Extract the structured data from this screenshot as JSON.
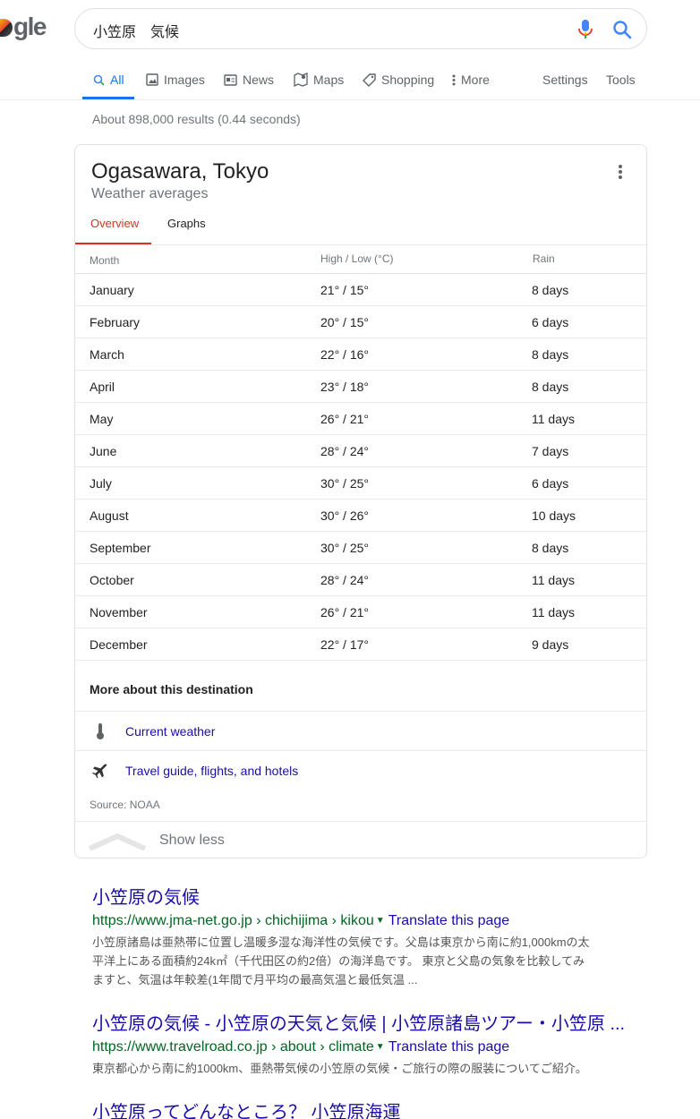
{
  "logo": {
    "text_o": "o",
    "text_gle": "gle"
  },
  "search": {
    "query": "小笠原　気候"
  },
  "tabs": [
    {
      "label": "All"
    },
    {
      "label": "Images"
    },
    {
      "label": "News"
    },
    {
      "label": "Maps"
    },
    {
      "label": "Shopping"
    },
    {
      "label": "More"
    }
  ],
  "tools": {
    "settings": "Settings",
    "tools": "Tools"
  },
  "stats": "About 898,000 results (0.44 seconds)",
  "card": {
    "title": "Ogasawara, Tokyo",
    "subtitle": "Weather averages",
    "tab_overview": "Overview",
    "tab_graphs": "Graphs",
    "col_month": "Month",
    "col_temp": "High / Low (°C)",
    "col_rain": "Rain",
    "rows": [
      {
        "month": "January",
        "temp": "21° / 15°",
        "rain": "8 days"
      },
      {
        "month": "February",
        "temp": "20° / 15°",
        "rain": "6 days"
      },
      {
        "month": "March",
        "temp": "22° / 16°",
        "rain": "8 days"
      },
      {
        "month": "April",
        "temp": "23° / 18°",
        "rain": "8 days"
      },
      {
        "month": "May",
        "temp": "26° / 21°",
        "rain": "11 days"
      },
      {
        "month": "June",
        "temp": "28° / 24°",
        "rain": "7 days"
      },
      {
        "month": "July",
        "temp": "30° / 25°",
        "rain": "6 days"
      },
      {
        "month": "August",
        "temp": "30° / 26°",
        "rain": "10 days"
      },
      {
        "month": "September",
        "temp": "30° / 25°",
        "rain": "8 days"
      },
      {
        "month": "October",
        "temp": "28° / 24°",
        "rain": "11 days"
      },
      {
        "month": "November",
        "temp": "26° / 21°",
        "rain": "11 days"
      },
      {
        "month": "December",
        "temp": "22° / 17°",
        "rain": "9 days"
      }
    ],
    "more_title": "More about this destination",
    "link_weather": "Current weather",
    "link_travel": "Travel guide, flights, and hotels",
    "source": "Source: NOAA",
    "show_less": "Show less"
  },
  "results": [
    {
      "title": "小笠原の気候",
      "url": "https://www.jma-net.go.jp › chichijima › kikou",
      "translate": "Translate this page",
      "snippet_lines": [
        "小笠原諸島は亜熱帯に位置し温暖多湿な海洋性の気候です。父島は東京から南に約1,000kmの太",
        "平洋上にある面積約24k㎡（千代田区の約2倍）の海洋島です。 東京と父島の気象を比較してみ",
        "ますと、気温は年較差(1年間で月平均の最高気温と最低気温 ..."
      ]
    },
    {
      "title": "小笠原の気候 - 小笠原の天気と気候 | 小笠原諸島ツアー・小笠原 ...",
      "url": "https://www.travelroad.co.jp › about › climate",
      "translate": "Translate this page",
      "snippet_lines": [
        "東京都心から南に約1000km、亜熱帯気候の小笠原の気候・ご旅行の際の服装についてご紹介。"
      ]
    },
    {
      "title": "小笠原ってどんなところ？ 小笠原海運"
    }
  ],
  "colors": {
    "accent": "#1a73e8",
    "link": "#1a0dab",
    "url_green": "#006621",
    "card_tab_red": "#d93025"
  }
}
